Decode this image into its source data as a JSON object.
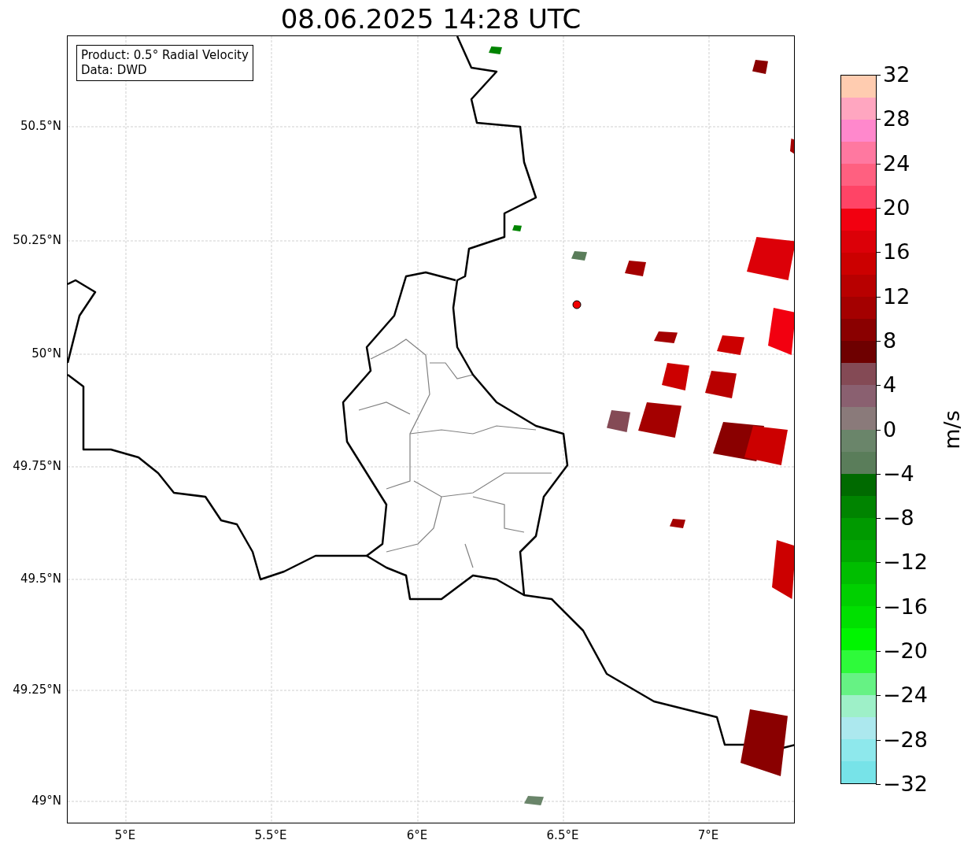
{
  "title": "08.06.2025 14:28 UTC",
  "info_box": {
    "lines": [
      "Product: 0.5° Radial Velocity",
      "Data: DWD"
    ]
  },
  "map": {
    "lat_labels": [
      "50.5°N",
      "50.25°N",
      "50°N",
      "49.75°N",
      "49.5°N",
      "49.25°N",
      "49°N"
    ],
    "lon_labels": [
      "5°E",
      "5.5°E",
      "6°E",
      "6.5°E",
      "7°E"
    ]
  },
  "colorbar": {
    "label": "m/s",
    "ticks": [
      "32",
      "28",
      "24",
      "20",
      "16",
      "12",
      "8",
      "4",
      "0",
      "−4",
      "−8",
      "−12",
      "−16",
      "−20",
      "−24",
      "−28",
      "−32"
    ],
    "segments": [
      {
        "color": "#ffccb0"
      },
      {
        "color": "#ffa6c0"
      },
      {
        "color": "#ff88cc"
      },
      {
        "color": "#ff78a0"
      },
      {
        "color": "#ff6080"
      },
      {
        "color": "#ff4466"
      },
      {
        "color": "#f20010"
      },
      {
        "color": "#dc0008"
      },
      {
        "color": "#cc0000"
      },
      {
        "color": "#b80000"
      },
      {
        "color": "#a40000"
      },
      {
        "color": "#8a0000"
      },
      {
        "color": "#6e0000"
      },
      {
        "color": "#844a55"
      },
      {
        "color": "#8a6070"
      },
      {
        "color": "#8a7a7a"
      },
      {
        "color": "#6a856a"
      },
      {
        "color": "#5a7d5a"
      },
      {
        "color": "#006a00"
      },
      {
        "color": "#008400"
      },
      {
        "color": "#009a00"
      },
      {
        "color": "#00a800"
      },
      {
        "color": "#00be00"
      },
      {
        "color": "#00d000"
      },
      {
        "color": "#00e000"
      },
      {
        "color": "#00f500"
      },
      {
        "color": "#2efa3a"
      },
      {
        "color": "#66f284"
      },
      {
        "color": "#9ef0c8"
      },
      {
        "color": "#ace8ee"
      },
      {
        "color": "#8ee8ec"
      },
      {
        "color": "#77e3e8"
      }
    ]
  }
}
